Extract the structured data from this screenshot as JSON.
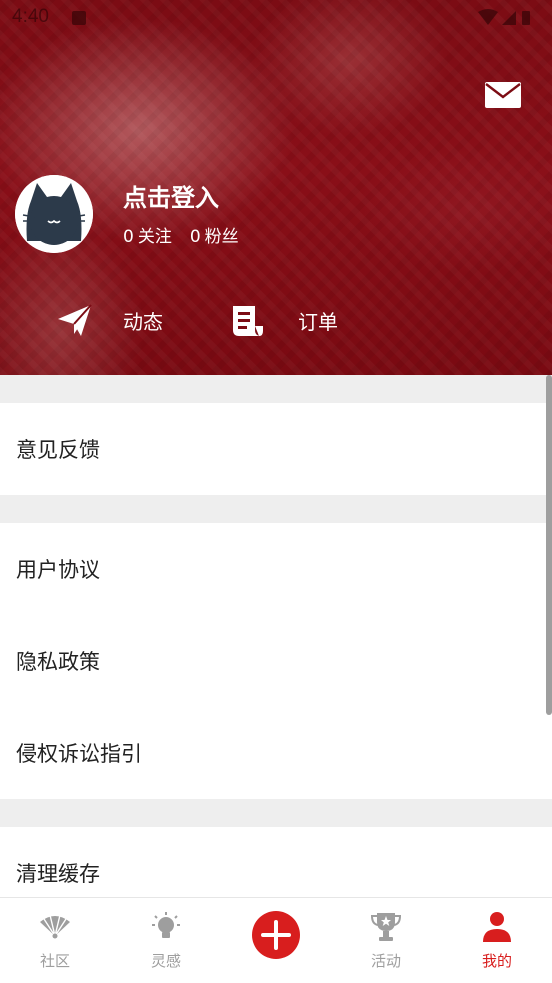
{
  "status_bar": {
    "time": "4:40"
  },
  "profile": {
    "login_text": "点击登入",
    "following_count": "0",
    "following_label": "关注",
    "followers_count": "0",
    "followers_label": "粉丝"
  },
  "actions": [
    {
      "label": "动态",
      "icon": "paper-plane-icon"
    },
    {
      "label": "订单",
      "icon": "receipt-scroll-icon"
    }
  ],
  "menu": {
    "feedback": "意见反馈",
    "user_agreement": "用户协议",
    "privacy_policy": "隐私政策",
    "infringement_guide": "侵权诉讼指引",
    "clear_cache": "清理缓存"
  },
  "tabs": [
    {
      "label": "社区",
      "icon": "fan-icon",
      "active": false
    },
    {
      "label": "灵感",
      "icon": "lightbulb-icon",
      "active": false
    },
    {
      "label": "",
      "icon": "plus-icon",
      "active": false
    },
    {
      "label": "活动",
      "icon": "trophy-icon",
      "active": false
    },
    {
      "label": "我的",
      "icon": "person-icon",
      "active": true
    }
  ],
  "colors": {
    "header_bg": "#7c0c14",
    "accent": "#d81e1e",
    "tab_inactive": "#9e9e9e",
    "section_gap": "#eeeeee"
  }
}
